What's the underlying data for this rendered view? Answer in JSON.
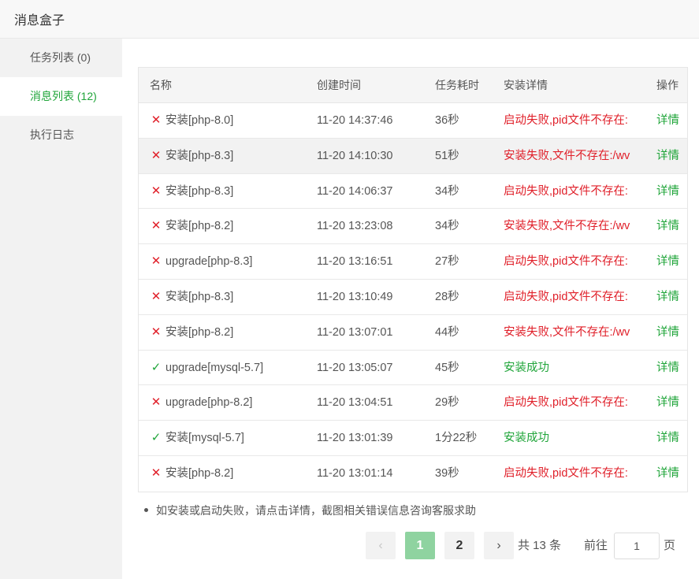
{
  "window": {
    "title": "消息盒子"
  },
  "sidebar": {
    "items": [
      {
        "label": "任务列表 (0)",
        "active": false
      },
      {
        "label": "消息列表 (12)",
        "active": true
      },
      {
        "label": "执行日志",
        "active": false
      }
    ]
  },
  "table": {
    "headers": {
      "name": "名称",
      "created": "创建时间",
      "duration": "任务耗时",
      "detail": "安装详情",
      "op": "操作"
    },
    "rows": [
      {
        "status": "fail",
        "name": "安装[php-8.0]",
        "created": "11-20 14:37:46",
        "duration": "36秒",
        "detail": "启动失败,pid文件不存在:",
        "op": "详情"
      },
      {
        "status": "fail",
        "name": "安装[php-8.3]",
        "created": "11-20 14:10:30",
        "duration": "51秒",
        "detail": "安装失败,文件不存在:/wv",
        "op": "详情"
      },
      {
        "status": "fail",
        "name": "安装[php-8.3]",
        "created": "11-20 14:06:37",
        "duration": "34秒",
        "detail": "启动失败,pid文件不存在:",
        "op": "详情"
      },
      {
        "status": "fail",
        "name": "安装[php-8.2]",
        "created": "11-20 13:23:08",
        "duration": "34秒",
        "detail": "安装失败,文件不存在:/wv",
        "op": "详情"
      },
      {
        "status": "fail",
        "name": "upgrade[php-8.3]",
        "created": "11-20 13:16:51",
        "duration": "27秒",
        "detail": "启动失败,pid文件不存在:",
        "op": "详情"
      },
      {
        "status": "fail",
        "name": "安装[php-8.3]",
        "created": "11-20 13:10:49",
        "duration": "28秒",
        "detail": "启动失败,pid文件不存在:",
        "op": "详情"
      },
      {
        "status": "fail",
        "name": "安装[php-8.2]",
        "created": "11-20 13:07:01",
        "duration": "44秒",
        "detail": "安装失败,文件不存在:/wv",
        "op": "详情"
      },
      {
        "status": "ok",
        "name": "upgrade[mysql-5.7]",
        "created": "11-20 13:05:07",
        "duration": "45秒",
        "detail": "安装成功",
        "op": "详情"
      },
      {
        "status": "fail",
        "name": "upgrade[php-8.2]",
        "created": "11-20 13:04:51",
        "duration": "29秒",
        "detail": "启动失败,pid文件不存在:",
        "op": "详情"
      },
      {
        "status": "ok",
        "name": "安装[mysql-5.7]",
        "created": "11-20 13:01:39",
        "duration": "1分22秒",
        "detail": "安装成功",
        "op": "详情"
      },
      {
        "status": "fail",
        "name": "安装[php-8.2]",
        "created": "11-20 13:01:14",
        "duration": "39秒",
        "detail": "启动失败,pid文件不存在:",
        "op": "详情"
      }
    ]
  },
  "tip": "如安装或启动失败，请点击详情，截图相关错误信息咨询客服求助",
  "pagination": {
    "prev": "‹",
    "pages": [
      "1",
      "2"
    ],
    "current": "1",
    "next": "›",
    "total": "共 13 条",
    "goto_label": "前往",
    "goto_value": "1",
    "page_suffix": "页"
  },
  "colors": {
    "accent": "#20a53a",
    "error": "#e0202a",
    "active_page": "#8fd3a0"
  },
  "icons": {
    "fail": "close-icon",
    "ok": "check-icon"
  }
}
